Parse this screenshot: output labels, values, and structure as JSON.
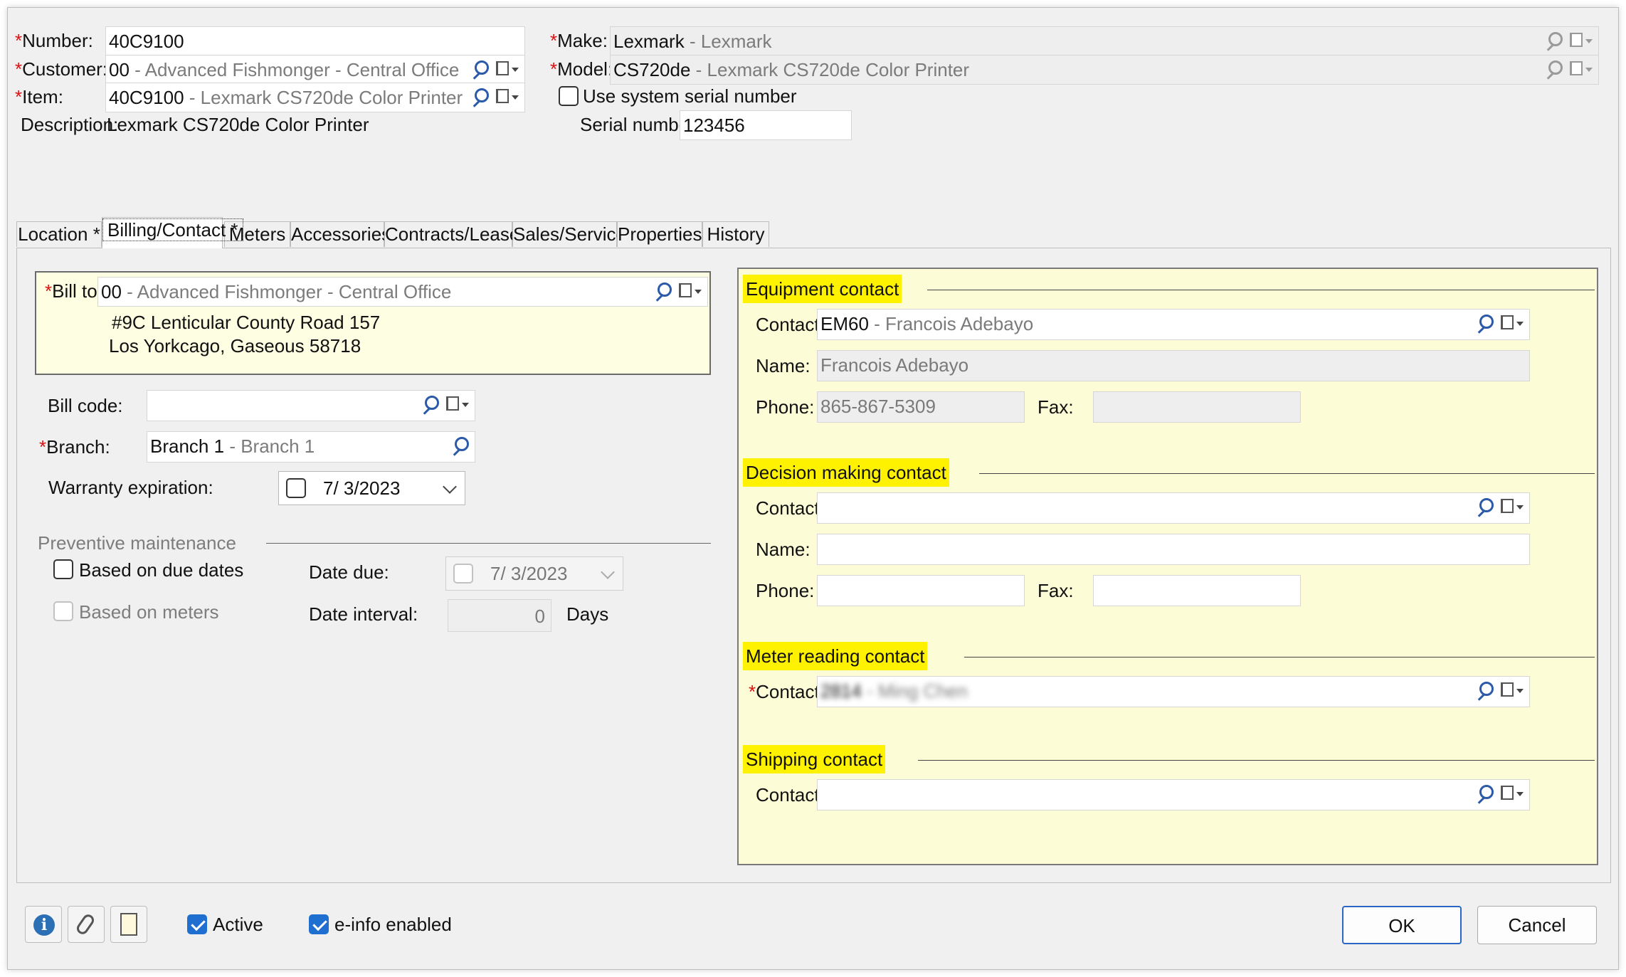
{
  "header": {
    "number": {
      "label": "Number:",
      "value": "40C9100"
    },
    "customer": {
      "label": "Customer:",
      "code": "00",
      "desc": "Advanced Fishmonger - Central Office"
    },
    "item": {
      "label": "Item:",
      "code": "40C9100",
      "desc": "Lexmark CS720de Color Printer"
    },
    "description": {
      "label": "Description:",
      "value": "Lexmark CS720de Color Printer"
    },
    "make": {
      "label": "Make:",
      "code": "Lexmark",
      "desc": "Lexmark"
    },
    "model": {
      "label": "Model:",
      "code": "CS720de",
      "desc": "Lexmark CS720de Color Printer"
    },
    "use_system_serial": "Use system serial number",
    "serial": {
      "label": "Serial number:",
      "value": "123456"
    }
  },
  "tabs": [
    {
      "label": "Location *"
    },
    {
      "label": "Billing/Contact *"
    },
    {
      "label": "Meters"
    },
    {
      "label": "Accessories"
    },
    {
      "label": "Contracts/Leases"
    },
    {
      "label": "Sales/Service"
    },
    {
      "label": "Properties"
    },
    {
      "label": "History"
    }
  ],
  "billing": {
    "bill_to": {
      "label": "Bill to:",
      "code": "00",
      "desc": "Advanced Fishmonger - Central Office"
    },
    "address1": "#9C Lenticular County Road 157",
    "address2": "Los Yorkcago, Gaseous 58718",
    "bill_code": {
      "label": "Bill code:",
      "value": ""
    },
    "branch": {
      "label": "Branch:",
      "code": "Branch 1",
      "desc": "Branch 1"
    },
    "warranty": {
      "label": "Warranty expiration:",
      "value": "7/  3/2023"
    },
    "pm": {
      "title": "Preventive maintenance",
      "based_due": "Based on due dates",
      "based_meters": "Based on meters",
      "date_due_label": "Date due:",
      "date_due_value": "7/  3/2023",
      "interval_label": "Date interval:",
      "interval_value": "0",
      "interval_unit": "Days"
    }
  },
  "contacts": {
    "equipment": {
      "title": "Equipment contact",
      "contact_label": "Contact:",
      "contact_code": "EM60",
      "contact_desc": "Francois Adebayo",
      "name_label": "Name:",
      "name_value": "Francois Adebayo",
      "phone_label": "Phone:",
      "phone_value": "865-867-5309",
      "fax_label": "Fax:",
      "fax_value": ""
    },
    "decision": {
      "title": "Decision making contact",
      "contact_label": "Contact:",
      "name_label": "Name:",
      "phone_label": "Phone:",
      "fax_label": "Fax:"
    },
    "meter": {
      "title": "Meter reading contact",
      "contact_label": "Contact:",
      "contact_code": "2814",
      "contact_desc": "Ming Chen"
    },
    "shipping": {
      "title": "Shipping contact",
      "contact_label": "Contact:"
    }
  },
  "footer": {
    "active": "Active",
    "einfo": "e-info enabled",
    "ok": "OK",
    "cancel": "Cancel"
  },
  "colors": {
    "highlight": "#fff200",
    "panel": "#fcfcd6",
    "accent": "#1f6fd0",
    "required": "#d11111"
  }
}
